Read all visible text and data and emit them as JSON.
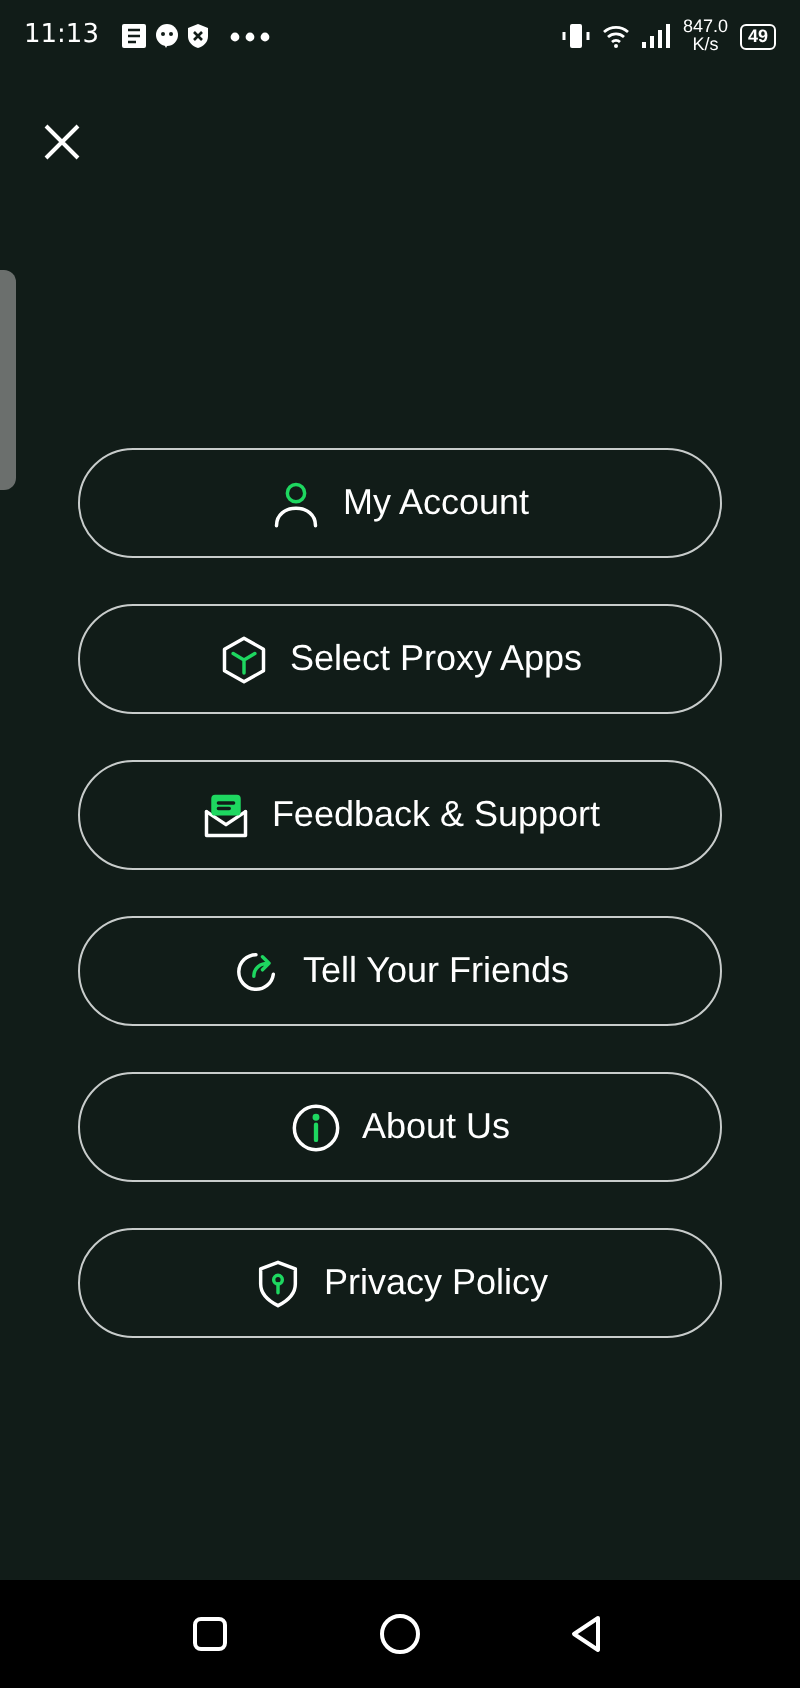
{
  "status_bar": {
    "time": "11:13",
    "net_speed": "847.0",
    "net_unit": "K/s",
    "battery": "49"
  },
  "menu": [
    {
      "kind": "account",
      "label": "My Account"
    },
    {
      "kind": "apps",
      "label": "Select Proxy Apps"
    },
    {
      "kind": "feedback",
      "label": "Feedback & Support"
    },
    {
      "kind": "share",
      "label": "Tell Your Friends"
    },
    {
      "kind": "about",
      "label": "About Us"
    },
    {
      "kind": "privacy",
      "label": "Privacy Policy"
    }
  ]
}
